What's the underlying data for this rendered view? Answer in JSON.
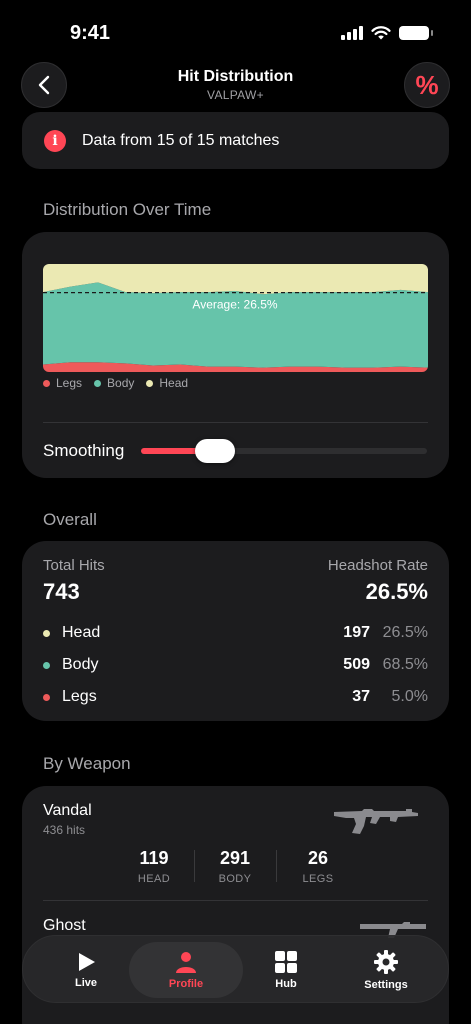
{
  "status_bar": {
    "time": "9:41"
  },
  "nav": {
    "title": "Hit Distribution",
    "subtitle": "VALPAW+",
    "percent_symbol": "%"
  },
  "banner": {
    "text": "Data from 15 of 15 matches"
  },
  "distribution_section": {
    "title": "Distribution Over Time",
    "average_label": "Average: 26.5%",
    "legend": [
      {
        "label": "Legs",
        "color": "#ee5a5a"
      },
      {
        "label": "Body",
        "color": "#66c4aa"
      },
      {
        "label": "Head",
        "color": "#ebe9b3"
      }
    ],
    "smoothing_label": "Smoothing",
    "smoothing_level": 0.22
  },
  "chart_data": {
    "type": "area",
    "stacked": true,
    "normalized": true,
    "x": [
      1,
      2,
      3,
      4,
      5,
      6,
      7,
      8,
      9,
      10,
      11,
      12,
      13,
      14,
      15
    ],
    "series": [
      {
        "name": "Legs",
        "color": "#ee5a5a",
        "values": [
          7,
          9,
          9,
          8,
          6,
          7,
          5,
          5,
          4,
          5,
          5,
          4,
          4,
          5,
          4
        ]
      },
      {
        "name": "Body",
        "color": "#66c4aa",
        "values": [
          67,
          70,
          74,
          66,
          67,
          67,
          69,
          70,
          68,
          69,
          69,
          70,
          70,
          71,
          70
        ]
      },
      {
        "name": "Head",
        "color": "#ebe9b3",
        "values": [
          26,
          21,
          17,
          26,
          27,
          26,
          26,
          25,
          28,
          26,
          26,
          26,
          26,
          24,
          26
        ]
      }
    ],
    "average_line": 26.5,
    "ylim": [
      0,
      100
    ],
    "legend_position": "bottom-left"
  },
  "overall": {
    "title": "Overall",
    "total_hits_label": "Total Hits",
    "total_hits_value": "743",
    "headshot_rate_label": "Headshot Rate",
    "headshot_rate_value": "26.5%",
    "rows": [
      {
        "label": "Head",
        "count": "197",
        "pct": "26.5%",
        "color": "#ebe9b3"
      },
      {
        "label": "Body",
        "count": "509",
        "pct": "68.5%",
        "color": "#66c4aa"
      },
      {
        "label": "Legs",
        "count": "37",
        "pct": "5.0%",
        "color": "#ee5a5a"
      }
    ]
  },
  "by_weapon": {
    "title": "By Weapon",
    "weapons": [
      {
        "name": "Vandal",
        "hits": "436 hits",
        "stats": [
          {
            "value": "119",
            "label": "HEAD"
          },
          {
            "value": "291",
            "label": "BODY"
          },
          {
            "value": "26",
            "label": "LEGS"
          }
        ]
      },
      {
        "name": "Ghost"
      }
    ]
  },
  "tabbar": {
    "tabs": [
      {
        "label": "Live",
        "icon": "play-icon"
      },
      {
        "label": "Profile",
        "icon": "person-icon",
        "active": true
      },
      {
        "label": "Hub",
        "icon": "grid-icon"
      },
      {
        "label": "Settings",
        "icon": "gear-icon"
      }
    ]
  },
  "colors": {
    "accent": "#ff4655",
    "card": "#1c1c1e",
    "background": "#000000"
  }
}
